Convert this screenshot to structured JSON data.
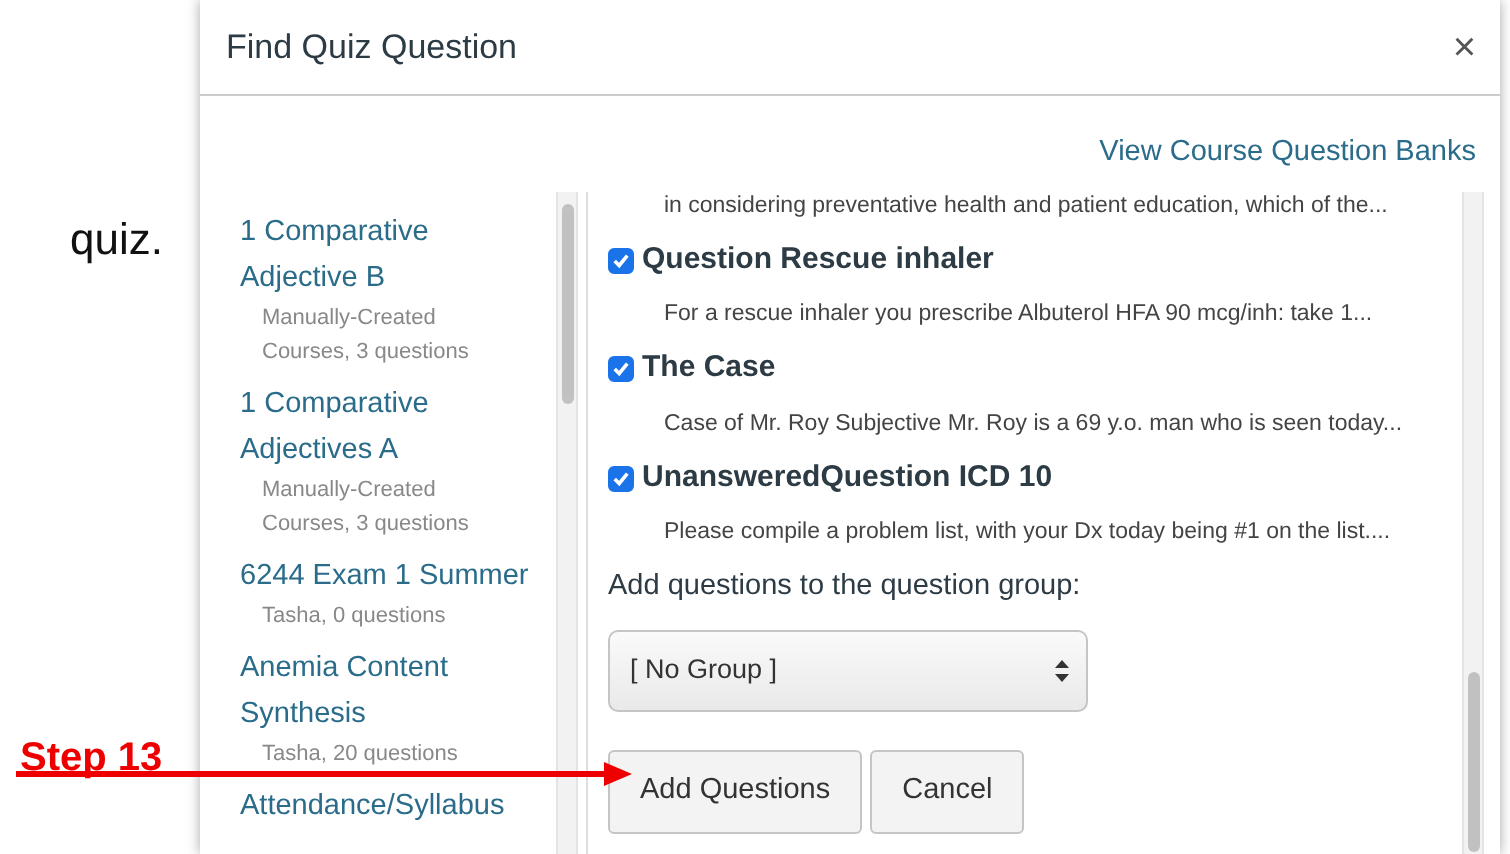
{
  "document": {
    "text": "quiz."
  },
  "annotation": {
    "label": "Step 13"
  },
  "dialog": {
    "title": "Find Quiz Question",
    "close": "×",
    "link": "View Course Question Banks",
    "banks": [
      {
        "name": "1 Comparative Adjective B",
        "meta": "Manually-Created Courses, 3 questions"
      },
      {
        "name": "1 Comparative Adjectives A",
        "meta": "Manually-Created Courses, 3 questions"
      },
      {
        "name": "6244 Exam 1 Summer",
        "meta": "Tasha, 0 questions"
      },
      {
        "name": "Anemia Content Synthesis",
        "meta": "Tasha, 20 questions"
      },
      {
        "name": "Attendance/Syllabus"
      }
    ],
    "top_snippet": "in considering preventative health and patient education, which of the...",
    "questions": [
      {
        "title": "Question Rescue inhaler",
        "checked": true,
        "description": "For a rescue inhaler you prescribe Albuterol HFA 90 mcg/inh: take 1..."
      },
      {
        "title": "The Case",
        "checked": true,
        "description": "Case of Mr. Roy Subjective Mr. Roy is a 69 y.o. man who is seen today..."
      },
      {
        "title": "UnansweredQuestion ICD 10",
        "checked": true,
        "description": "Please compile a problem list, with your Dx today being #1 on the list...."
      }
    ],
    "group_label": "Add questions to the question group:",
    "group_select": "[ No Group ]",
    "buttons": [
      {
        "label": "Add Questions"
      },
      {
        "label": "Cancel"
      }
    ]
  }
}
